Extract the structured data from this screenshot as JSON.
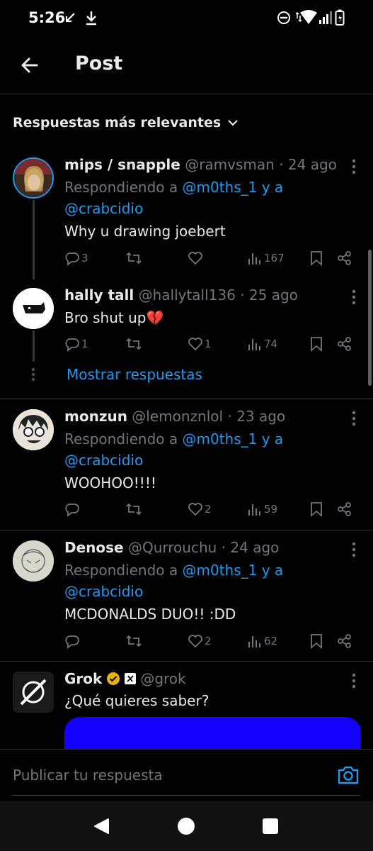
{
  "status_bar": {
    "time": "5:26"
  },
  "header": {
    "title": "Post"
  },
  "sort": {
    "label": "Respuestas más relevantes"
  },
  "replies": [
    {
      "name": "mips / snapple",
      "handle": "@ramvsman · 24 ago",
      "reply_prefix": "Respondiendo a ",
      "mention1": "@m0ths_1",
      "conj": " y a",
      "mention2": "@crabcidio",
      "text": "Why u drawing joebert",
      "replies_count": "3",
      "likes": "",
      "views": "167"
    },
    {
      "name": "hally tall",
      "handle": "@hallytall136 · 25 ago",
      "text": "Bro shut up💔",
      "replies_count": "1",
      "likes": "1",
      "views": "74"
    },
    {
      "name": "monzun",
      "handle": "@lemonznlol · 23 ago",
      "reply_prefix": "Respondiendo a ",
      "mention1": "@m0ths_1",
      "conj": " y a",
      "mention2": "@crabcidio",
      "text": "WOOHOO!!!!",
      "replies_count": "",
      "likes": "2",
      "views": "59"
    },
    {
      "name": "Denose",
      "handle": "@Qurrouchu · 24 ago",
      "reply_prefix": "Respondiendo a ",
      "mention1": "@m0ths_1",
      "conj": " y a",
      "mention2": "@crabcidio",
      "text": "MCDONALDS DUO!! :DD",
      "replies_count": "",
      "likes": "2",
      "views": "62"
    }
  ],
  "show_replies": "Mostrar respuestas",
  "grok": {
    "name": "Grok",
    "handle": "@grok",
    "text": "¿Qué quieres saber?",
    "card_color": "#1400ff"
  },
  "reply_bar": {
    "placeholder": "Publicar tu respuesta"
  },
  "colors": {
    "accent": "#1d9bf0",
    "verified": "#e8b20c",
    "broken_heart": "#e0245e"
  }
}
